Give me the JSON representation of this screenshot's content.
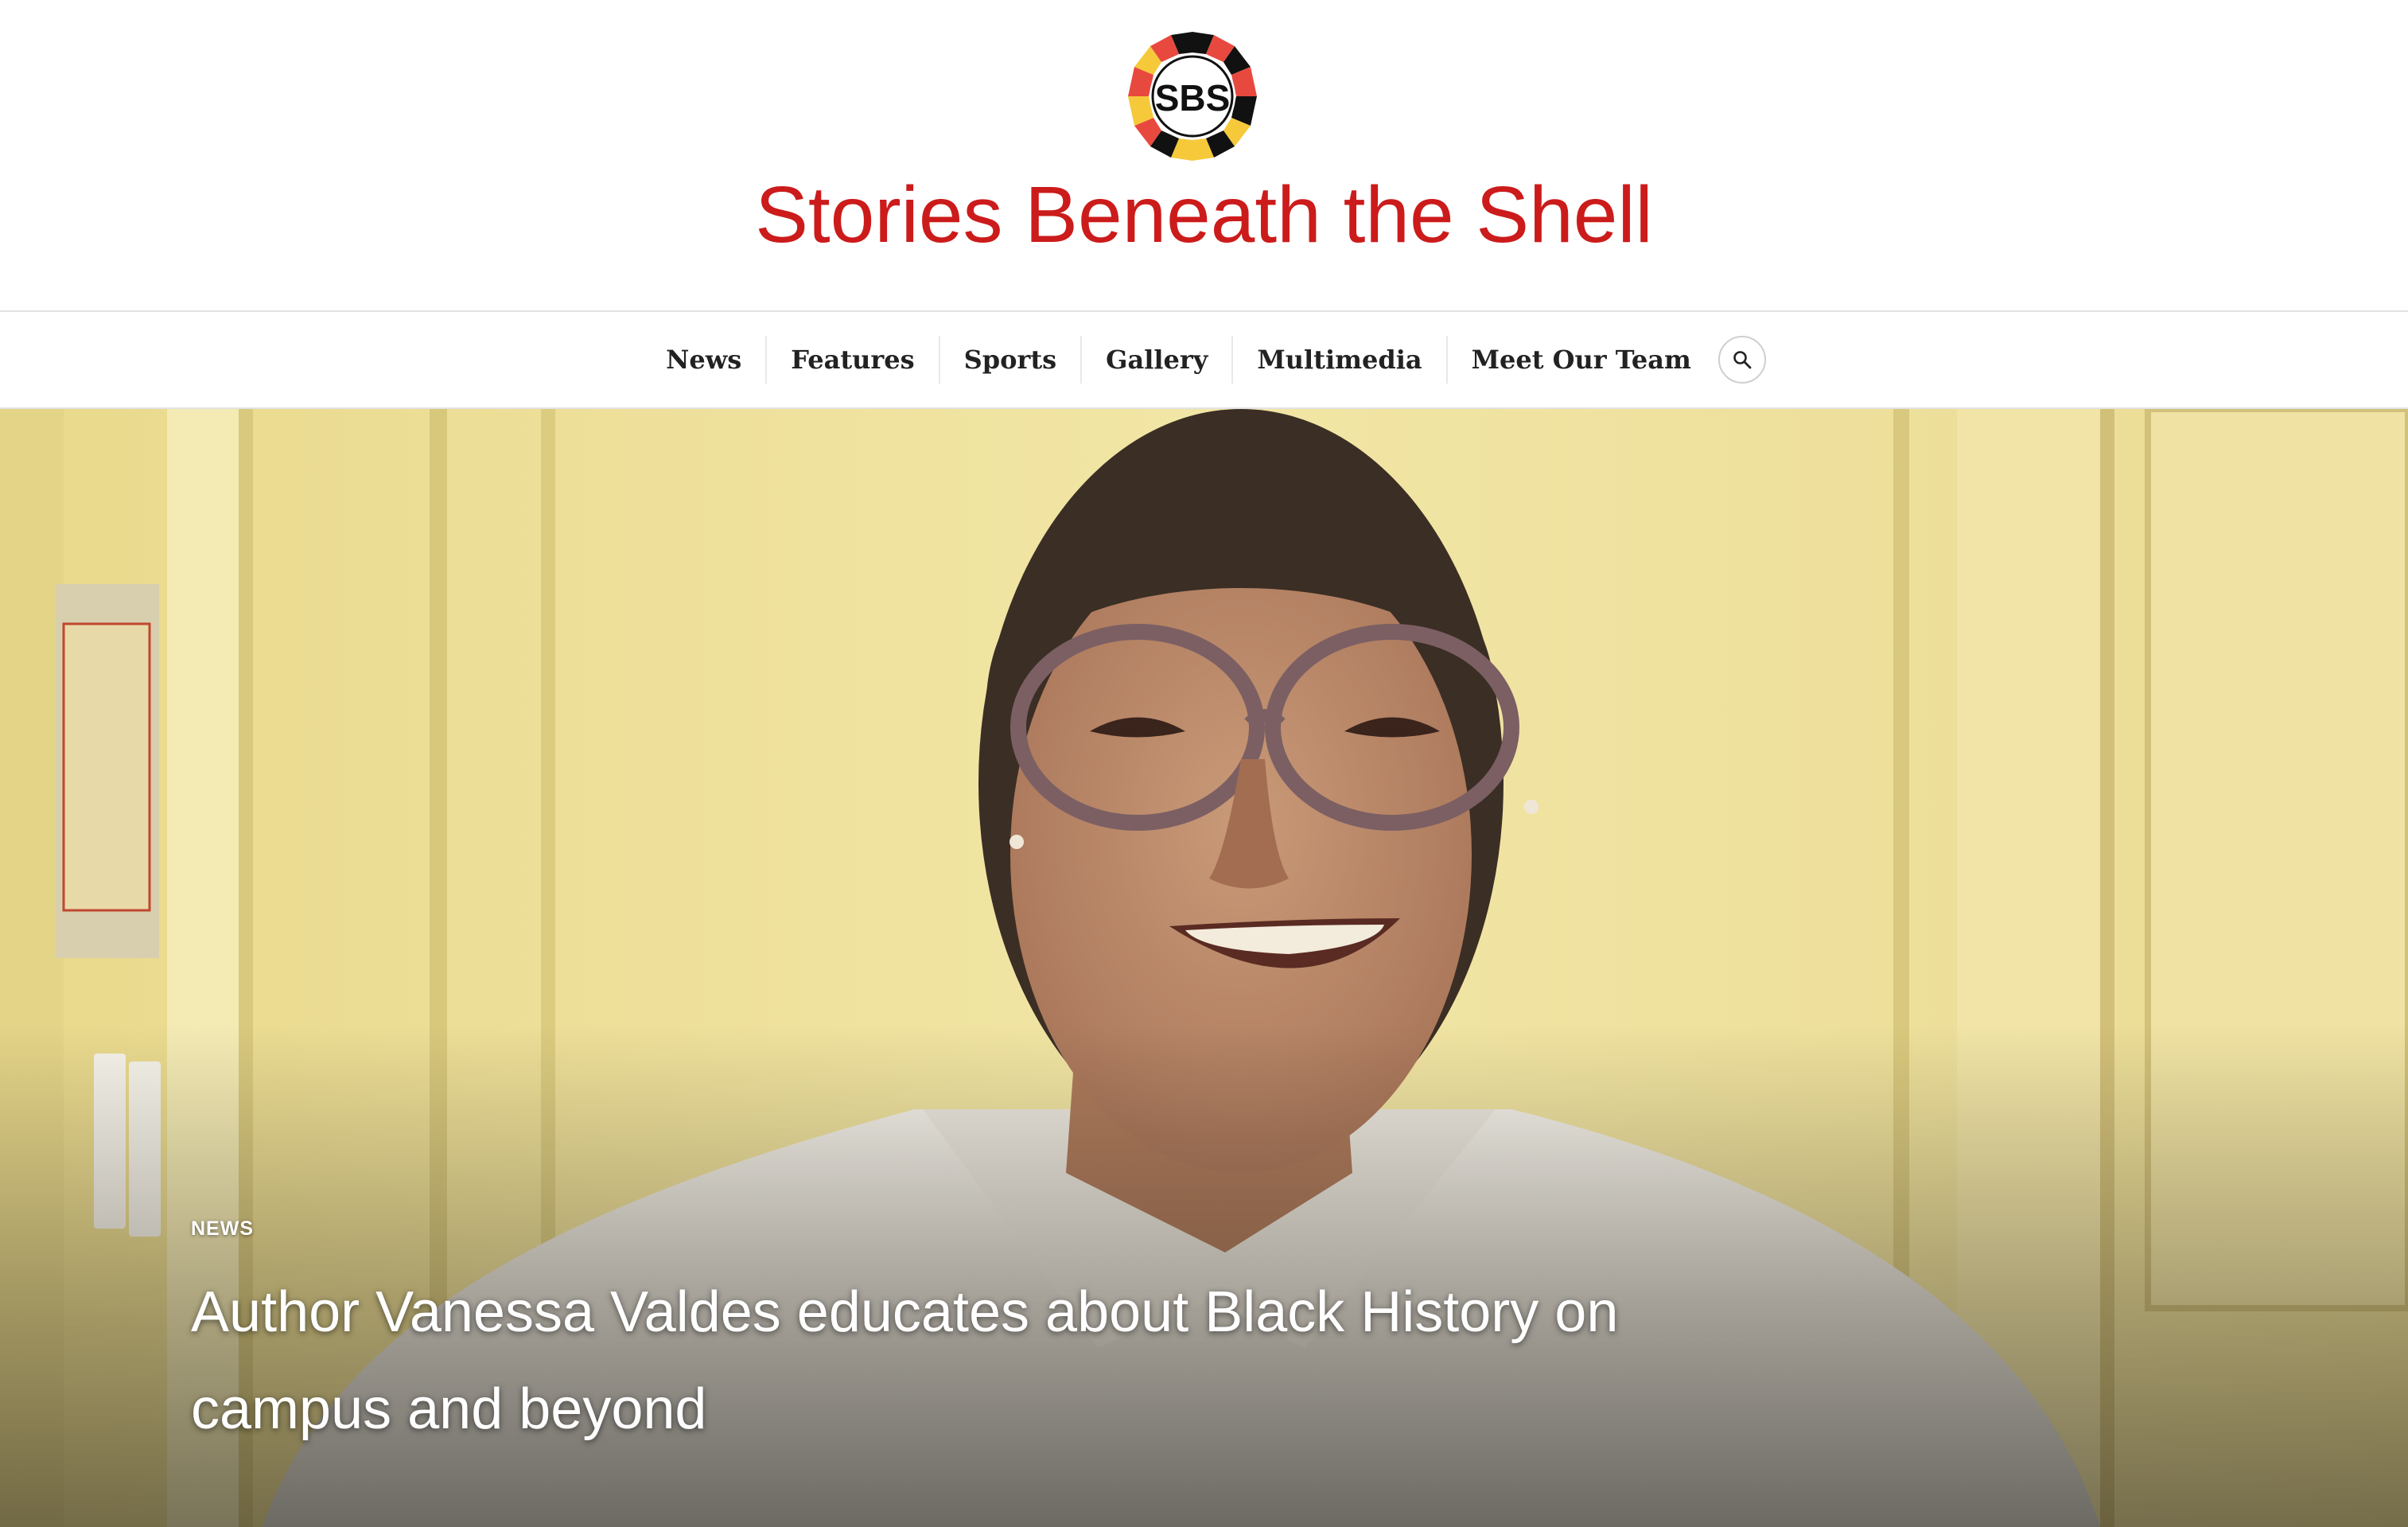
{
  "header": {
    "logo_text": "SBS",
    "site_title": "Stories Beneath the Shell"
  },
  "nav": {
    "items": [
      {
        "label": "News"
      },
      {
        "label": "Features"
      },
      {
        "label": "Sports"
      },
      {
        "label": "Gallery"
      },
      {
        "label": "Multimedia"
      },
      {
        "label": "Meet Our Team"
      }
    ],
    "search_icon": "search-icon"
  },
  "hero": {
    "category": "NEWS",
    "title": "Author Vanessa Valdes educates about Black History on campus and beyond",
    "image_subject": "portrait photo of a smiling woman with glasses in front of a pale yellow wall"
  },
  "colors": {
    "title_red": "#cc1b1b",
    "logo_red": "#e8493f",
    "logo_yellow": "#f5c93a",
    "logo_black": "#111111",
    "wall_yellow": "#eedf97"
  }
}
